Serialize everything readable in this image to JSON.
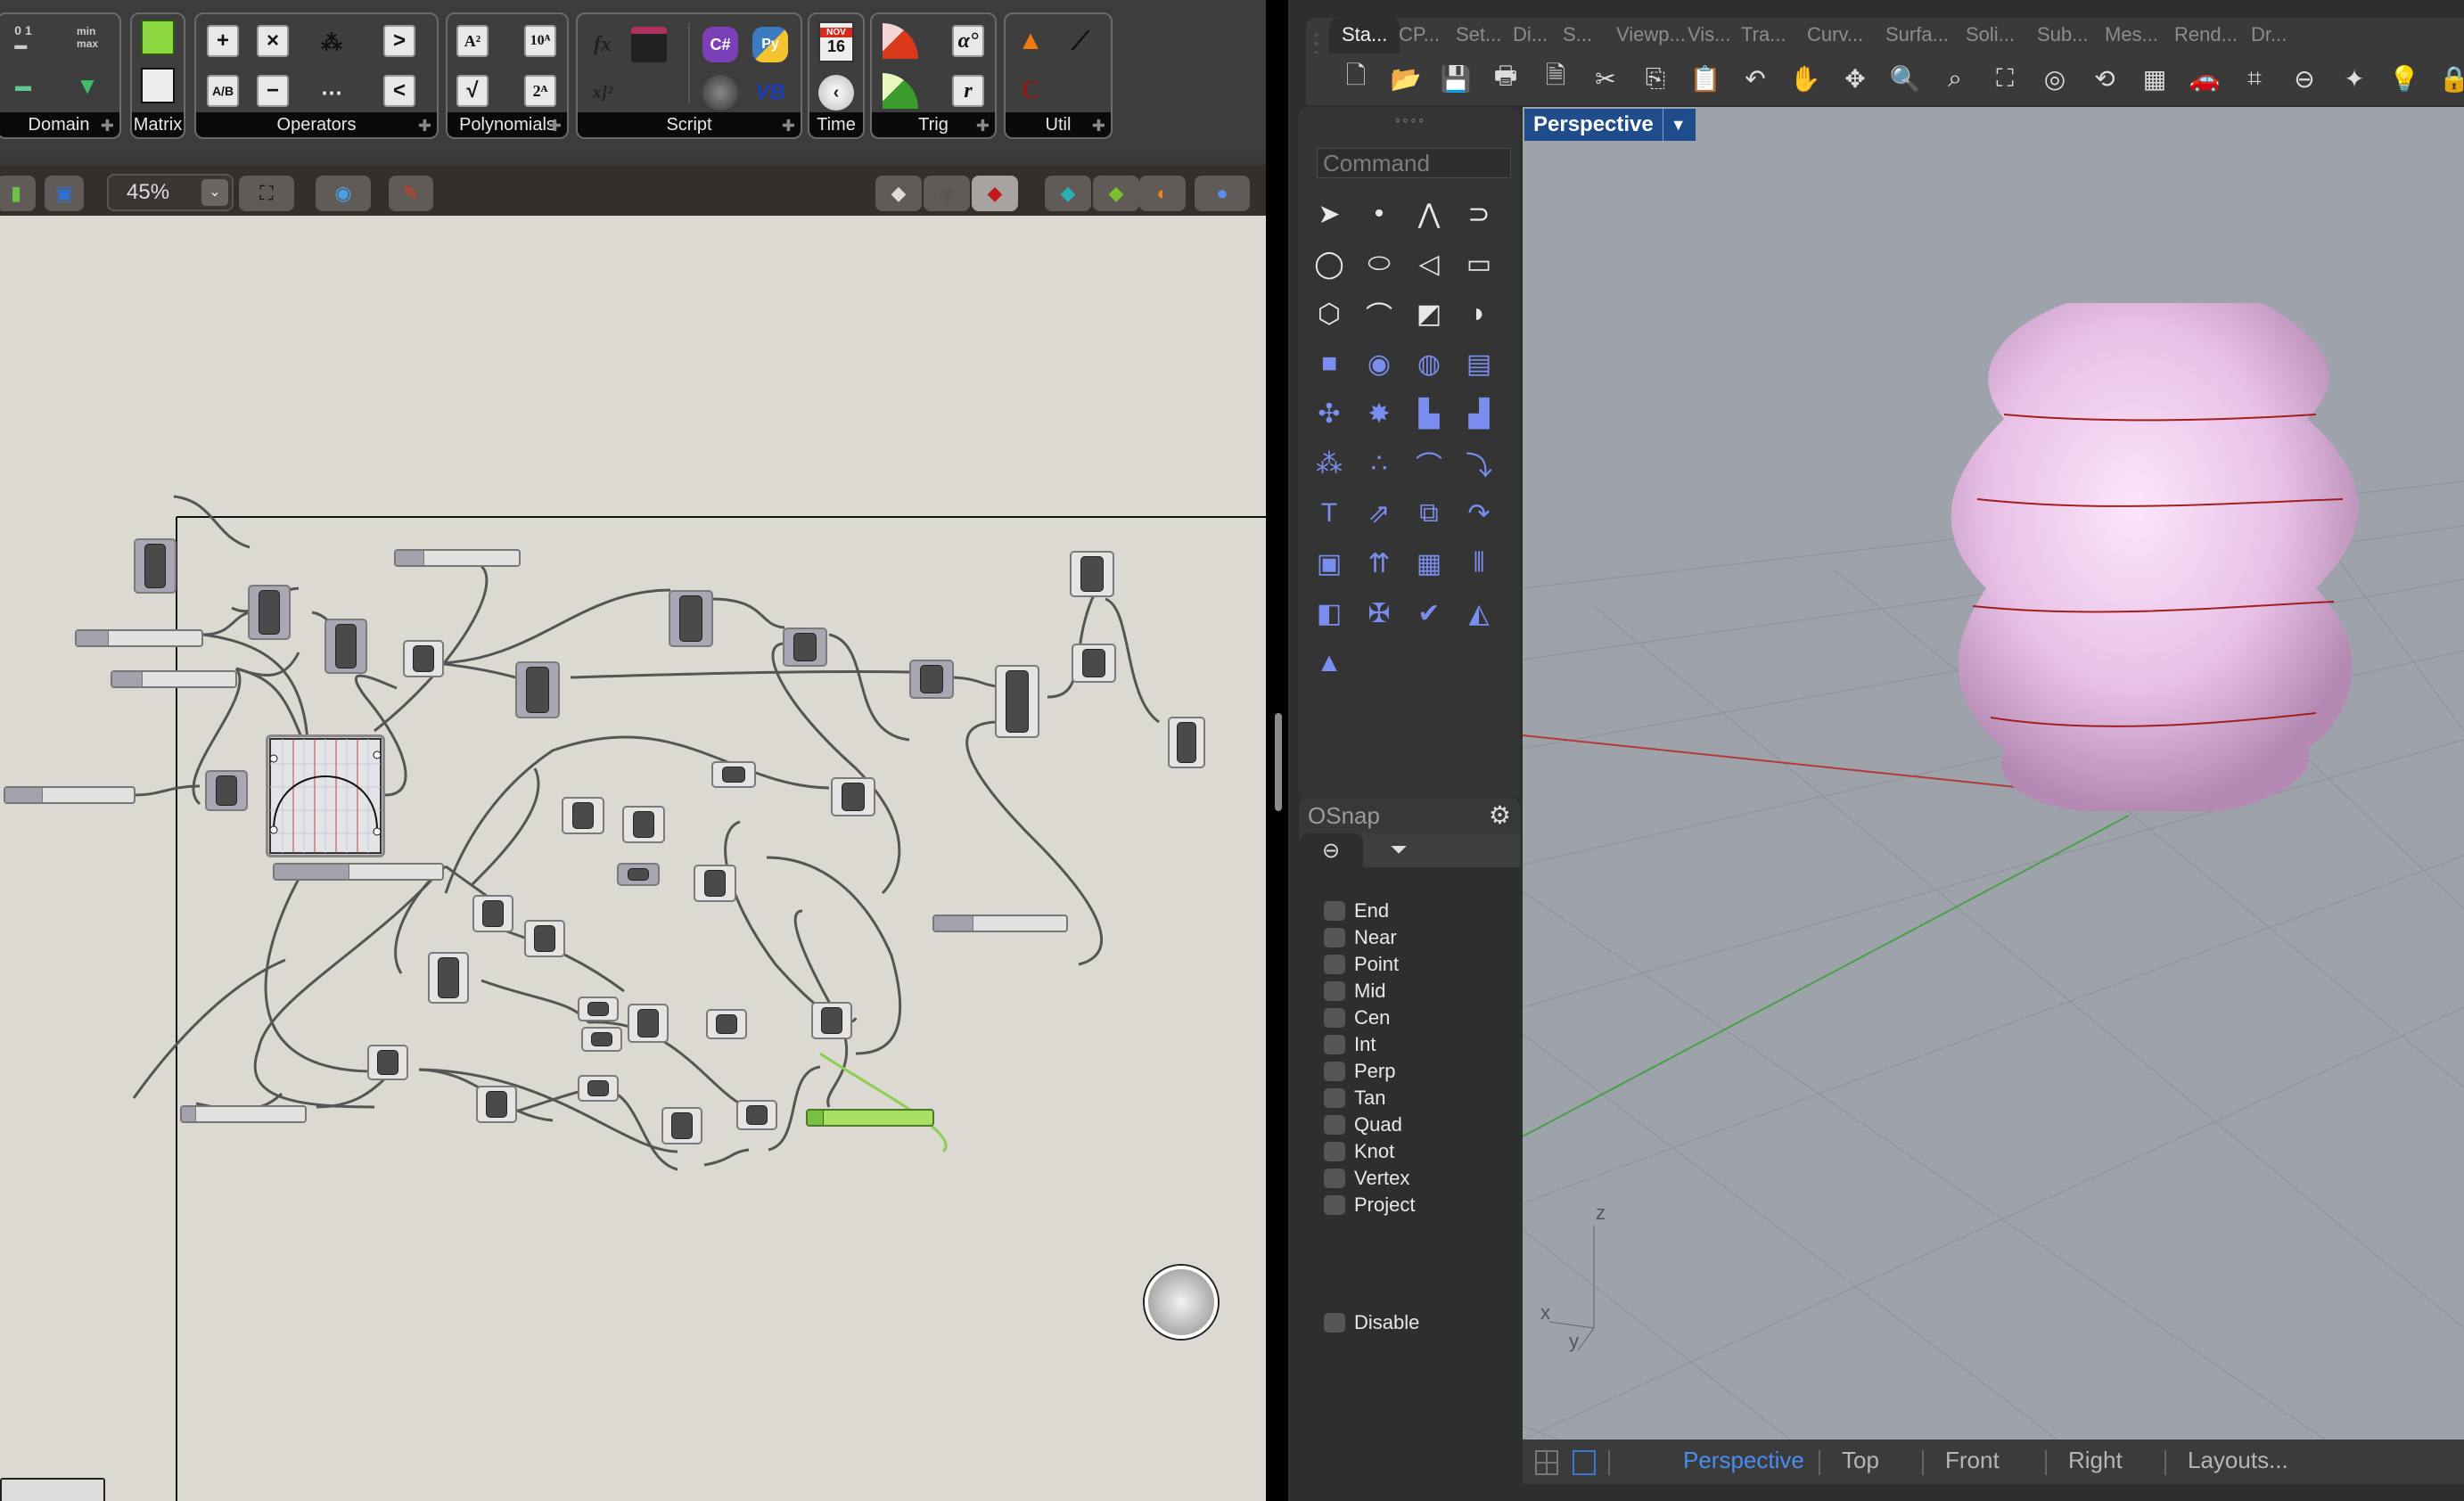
{
  "grasshopper": {
    "ribbon_groups": [
      {
        "label": "Domain",
        "icons": [
          "construct-domain-icon",
          "deconstruct-domain-icon",
          "bounds-icon",
          "remap-icon"
        ]
      },
      {
        "label": "Matrix",
        "icons": [
          "matrix-green-icon",
          "matrix-white-icon"
        ]
      },
      {
        "label": "Operators",
        "icons": [
          "addition-icon",
          "multiplication-icon",
          "mass-addition-icon",
          "larger-than-icon",
          "division-icon",
          "subtraction-icon",
          "series-icon",
          "smaller-than-icon"
        ],
        "glyphs": [
          "+",
          "×",
          "⁂",
          ">",
          "A/B",
          "−",
          "⋯",
          "<"
        ]
      },
      {
        "label": "Polynomials",
        "icons": [
          "power-icon",
          "power-of-10-icon",
          "square-root-icon",
          "power-of-2-icon"
        ],
        "glyphs": [
          "A²",
          "10ᴬ",
          "√",
          "2ᴬ"
        ]
      },
      {
        "label": "Script",
        "icons": [
          "expression-icon",
          "script-editor-icon",
          "csharp-icon",
          "python-icon",
          "evaluate-icon",
          "ghpython-icon",
          "vb-icon"
        ],
        "glyphs": [
          "fx",
          "",
          "C#",
          "Py",
          "x]²",
          "",
          "VB"
        ]
      },
      {
        "label": "Time",
        "icons": [
          "calendar-icon",
          "clock-icon"
        ],
        "calendar_month": "NOV",
        "calendar_day": "16"
      },
      {
        "label": "Trig",
        "icons": [
          "radians-icon",
          "degrees-icon",
          "triangle-icon",
          "r-icon"
        ],
        "glyphs": [
          "",
          "α°",
          "",
          "r"
        ]
      },
      {
        "label": "Util",
        "icons": [
          "gaussian-icon",
          "linear-icon",
          "constant-icon"
        ]
      }
    ],
    "toolbar": {
      "zoom_value": "45%",
      "buttons": [
        "open-file",
        "save-file",
        "zoom-extents",
        "preview-toggle",
        "sketch-pen"
      ],
      "display_modes": [
        "preview-wireframe",
        "preview-off",
        "preview-shaded",
        "preview-selected",
        "preview-material",
        "preview-mesh",
        "preview-document"
      ]
    },
    "canvas": {
      "background": "#dbd9d2",
      "graph_mapper_type": "parabola",
      "slider_count": 9,
      "active_slider_color": "#a8e066"
    }
  },
  "rhino": {
    "tabs": [
      "Sta...",
      "CP...",
      "Set...",
      "Di...",
      "S...",
      "Viewp...",
      "Vis...",
      "Tra...",
      "Curv...",
      "Surfa...",
      "Soli...",
      "Sub...",
      "Mes...",
      "Rend...",
      "Dr..."
    ],
    "active_tab": "Sta...",
    "toolbar_icons": [
      "new-icon",
      "open-icon",
      "save-icon",
      "print-icon",
      "import-icon",
      "cut-icon",
      "copy-icon",
      "paste-icon",
      "undo-icon",
      "pan-icon",
      "rotate-view-icon",
      "zoom-icon",
      "zoom-window-icon",
      "zoom-extents-icon",
      "zoom-selected-icon",
      "undo-view-icon",
      "four-viewports-icon",
      "car-icon",
      "cplane-icon",
      "osnap-icon",
      "light-icon",
      "bulb-icon",
      "lock-icon"
    ],
    "command_placeholder": "Command",
    "viewport_label": "Perspective",
    "osnap": {
      "title": "OSnap",
      "items": [
        "End",
        "Near",
        "Point",
        "Mid",
        "Cen",
        "Int",
        "Perp",
        "Tan",
        "Quad",
        "Knot",
        "Vertex",
        "Project"
      ],
      "disable_label": "Disable"
    },
    "view_tabs": [
      "Perspective",
      "Top",
      "Front",
      "Right",
      "Layouts..."
    ],
    "active_view_tab": "Perspective",
    "axis_labels": {
      "z": "z",
      "x": "x",
      "y": "y"
    },
    "model_color": "#e8c0e6"
  }
}
